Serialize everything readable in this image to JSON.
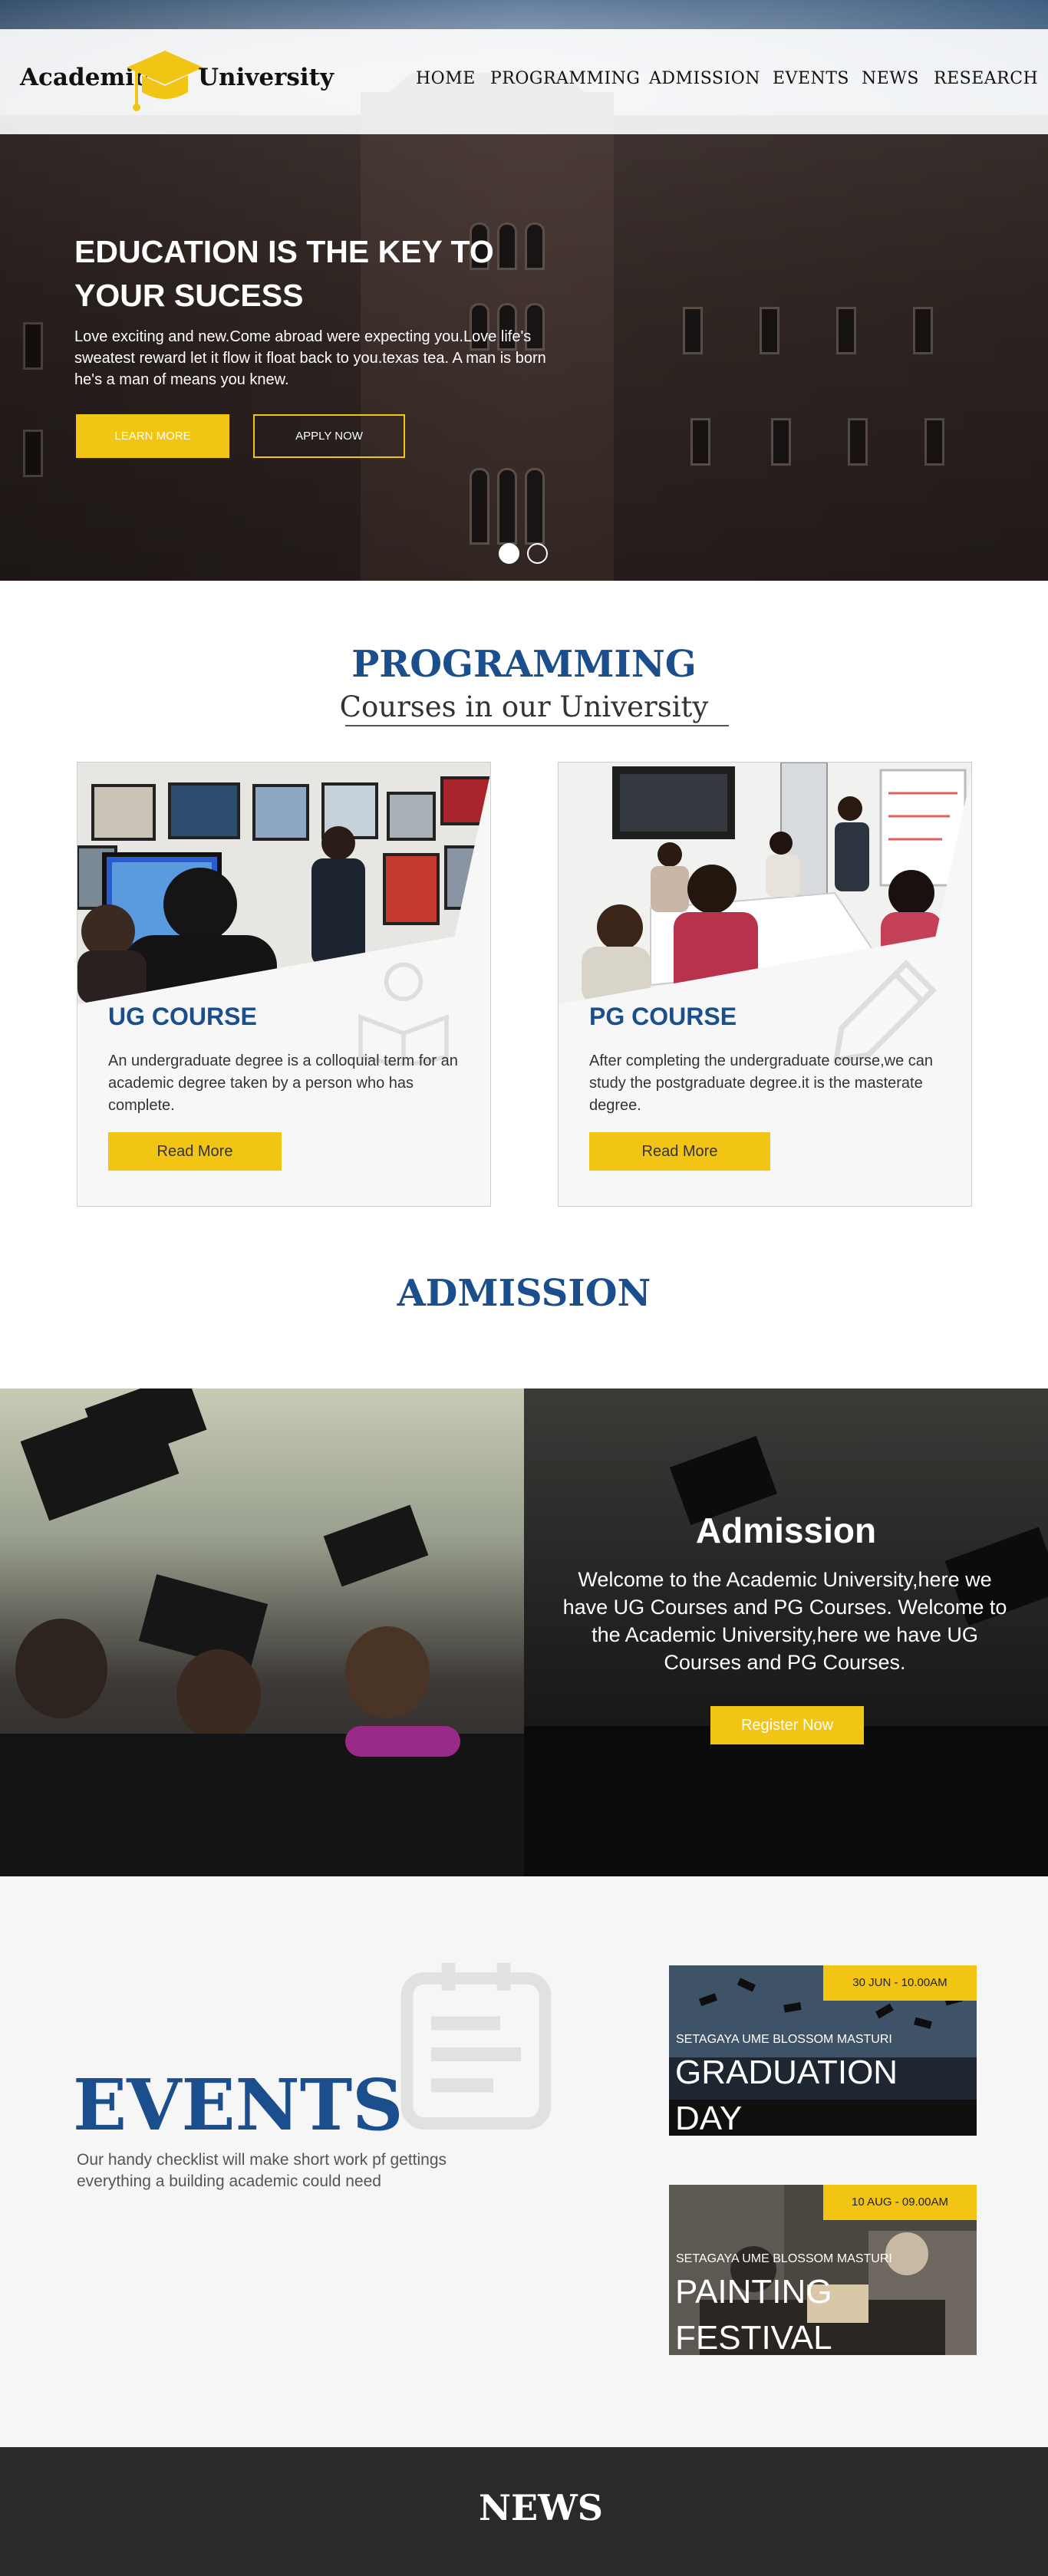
{
  "header": {
    "logo_left": "Academic",
    "logo_right": "University",
    "nav": [
      "HOME",
      "PROGRAMMING",
      "ADMISSION",
      "EVENTS",
      "NEWS",
      "RESEARCH"
    ]
  },
  "hero": {
    "title": "EDUCATION IS THE KEY TO YOUR SUCESS",
    "subtitle": "Love exciting and new.Come abroad were expecting you.Love life's sweatest reward let it flow it float back to you.texas tea. A man is born he's a man of means you knew.",
    "learn_more": "LEARN MORE",
    "apply_now": "APPLY NOW"
  },
  "programming": {
    "title": "PROGRAMMING",
    "subtitle": "Courses in our  University",
    "cards": [
      {
        "title": "UG COURSE",
        "text": "An undergraduate degree is a colloquial term for an academic degree taken by a person who has complete.",
        "button": "Read More"
      },
      {
        "title": "PG COURSE",
        "text": "After completing the undergraduate course,we can study the postgraduate degree.it is the masterate degree.",
        "button": "Read More"
      }
    ]
  },
  "admission": {
    "title": "ADMISSION",
    "box_title": "Admission",
    "box_text": "Welcome to the Academic University,here we have UG Courses and PG Courses. Welcome to the Academic University,here we have UG Courses and PG Courses.",
    "button": "Register Now"
  },
  "events": {
    "title": "EVENTS",
    "subtitle": "Our handy checklist will make short work pf gettings everything a building academic could need",
    "items": [
      {
        "date": "30 JUN - 10.00AM",
        "org": "SETAGAYA UME BLOSSOM MASTURI",
        "name": "GRADUATION DAY"
      },
      {
        "date": "10 AUG - 09.00AM",
        "org": "SETAGAYA UME BLOSSOM MASTURI",
        "name": "PAINTING FESTIVAL"
      }
    ]
  },
  "news": {
    "title": "NEWS"
  },
  "colors": {
    "brand_blue": "#1a4e8c",
    "accent_yellow": "#f2c414",
    "footer_dark": "#2b2929"
  }
}
